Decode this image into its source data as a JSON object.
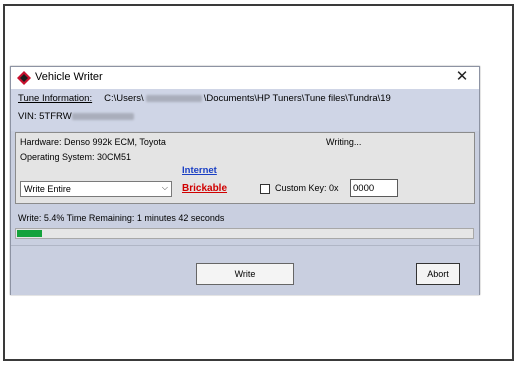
{
  "window": {
    "title": "Vehicle Writer",
    "close_symbol": "✕",
    "icon": "tuner-logo-icon"
  },
  "info": {
    "tune_label": "Tune Information:",
    "tune_path_start": "C:\\Users\\",
    "tune_path_end": "\\Documents\\HP Tuners\\Tune files\\Tundra\\19",
    "vin_label": "VIN: 5TFRW"
  },
  "status": {
    "hardware": "Hardware: Denso 992k ECM,  Toyota",
    "os": "Operating System: 30CM51",
    "state": "Writing..."
  },
  "links": {
    "internet": "Internet",
    "brickable": "Brickable"
  },
  "write_mode": {
    "selected": "Write Entire"
  },
  "custom_key": {
    "label": "Custom Key: 0x",
    "value": "0000",
    "checked": false
  },
  "progress": {
    "text": "Write: 5.4% Time Remaining: 1 minutes 42 seconds",
    "percent": 5.4,
    "color": "#14a23c"
  },
  "buttons": {
    "write": "Write",
    "abort": "Abort"
  }
}
